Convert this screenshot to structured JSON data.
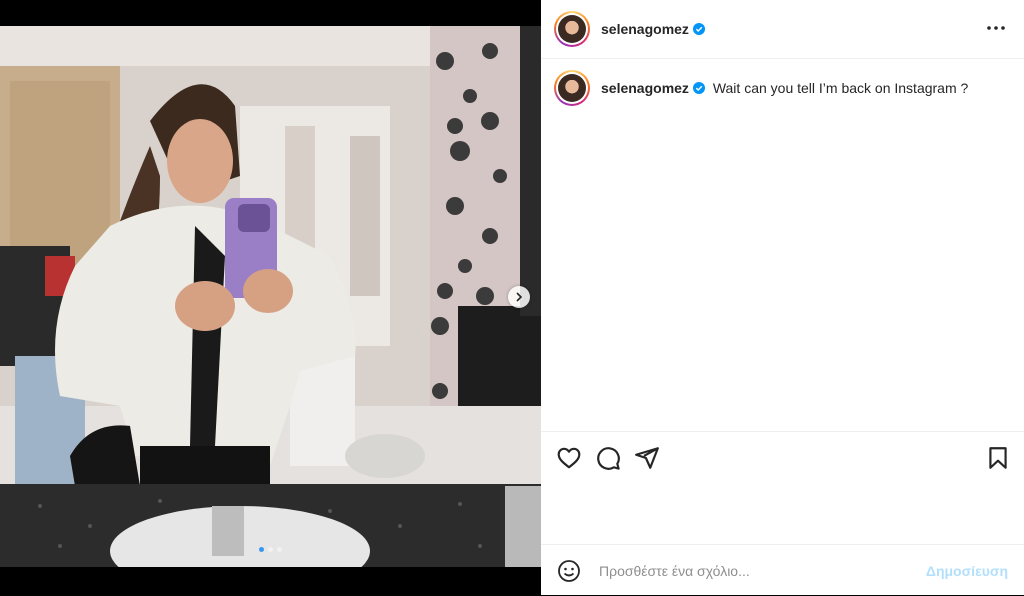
{
  "post": {
    "username": "selenagomez",
    "verified": true,
    "caption": "Wait can you tell I’m back on Instagram ?",
    "carousel_slide": 1,
    "carousel_total": 3
  },
  "comment_box": {
    "placeholder": "Προσθέστε ένα σχόλιο...",
    "post_label": "Δημοσίευση"
  },
  "icons": {
    "more": "more-horizontal-icon",
    "like": "heart-icon",
    "comment": "comment-icon",
    "share": "send-icon",
    "save": "bookmark-icon",
    "emoji": "emoji-icon",
    "next": "chevron-right-icon",
    "verified": "verified-badge-icon"
  },
  "colors": {
    "verified_blue": "#0095f6",
    "post_button_disabled": "#b2dffc",
    "active_dot": "#3897f0"
  }
}
